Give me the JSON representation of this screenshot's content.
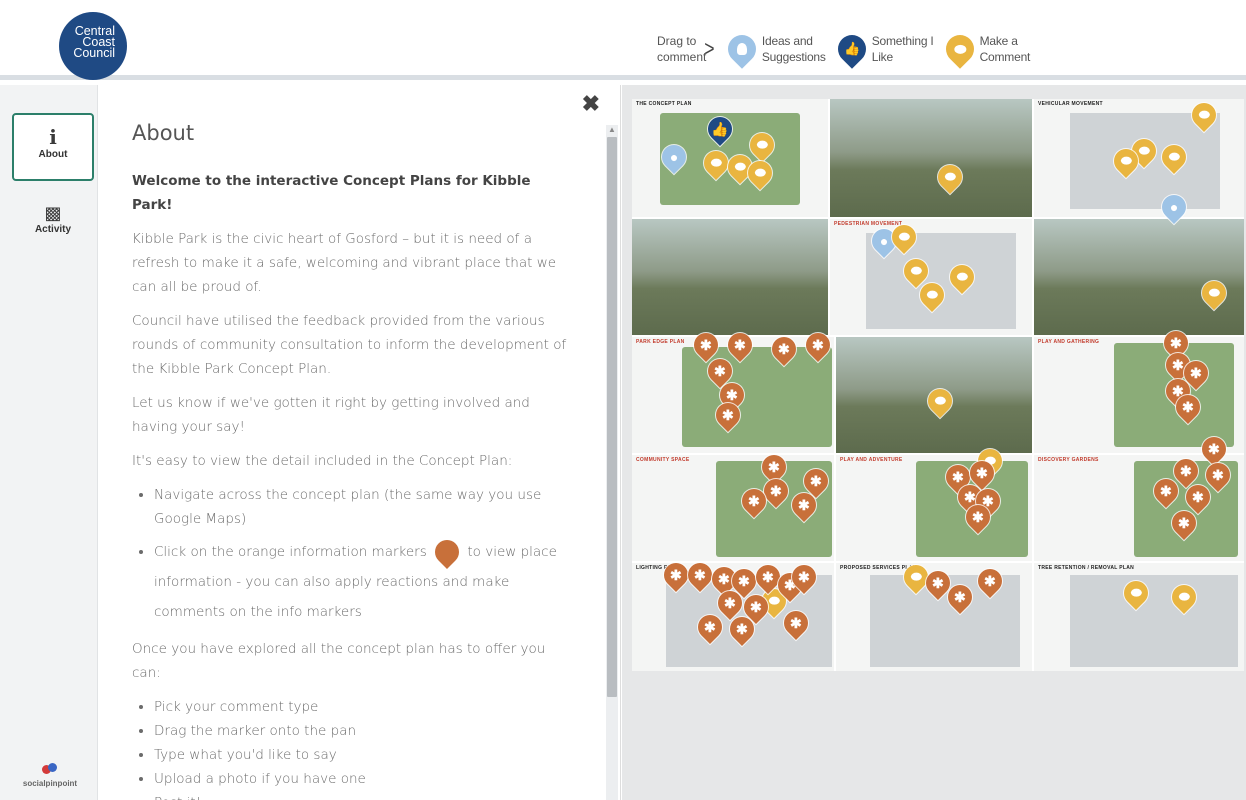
{
  "header": {
    "logo_lines": [
      "Central",
      "Coast",
      "Council"
    ],
    "legend": {
      "drag_line1": "Drag to",
      "drag_line2": "comment",
      "items": [
        {
          "line1": "Ideas and",
          "line2": "Suggestions",
          "color": "#9dc3e6",
          "icon": "lightbulb-icon"
        },
        {
          "line1": "Something I",
          "line2": "Like",
          "color": "#1f4a84",
          "icon": "thumbs-up-icon"
        },
        {
          "line1": "Make a",
          "line2": "Comment",
          "color": "#e9b540",
          "icon": "speech-bubble-icon"
        }
      ]
    }
  },
  "sidebar": {
    "items": [
      {
        "label": "About",
        "icon": "info-icon"
      },
      {
        "label": "Activity",
        "icon": "comments-icon"
      }
    ],
    "brand": "socialpinpoint"
  },
  "about": {
    "title": "About",
    "heading": "Welcome to the interactive Concept Plans for Kibble Park!",
    "p1": "Kibble Park is the civic heart of Gosford – but it is need of a refresh to make it a safe, welcoming and vibrant place that we can all be proud of.",
    "p2": "Council have utilised the feedback provided from the various rounds of community consultation to inform the development of the Kibble Park Concept Plan.",
    "p3": "Let us know if we've gotten it right by getting involved and having your say!",
    "p4": "It's easy to view the detail included in the Concept Plan:",
    "list1": [
      "Navigate across the concept plan (the same way you use Google Maps)",
      "Click on the orange information markers",
      "to view place information - you can also apply reactions and make comments on the info markers"
    ],
    "p5": "Once you have explored all the concept plan has to offer you can:",
    "list2": [
      "Pick your comment type",
      "Drag the marker onto the pan",
      "Type what you'd like to say",
      "Upload a photo if you have one",
      "Post it!"
    ]
  },
  "map": {
    "tile_titles": {
      "t1": "THE CONCEPT PLAN",
      "t3": "VEHICULAR MOVEMENT",
      "t5": "PEDESTRIAN MOVEMENT",
      "t7": "PARK EDGE PLAN",
      "t9": "PLAY AND GATHERING",
      "t10": "COMMUNITY SPACE",
      "t11": "PLAY AND ADVENTURE",
      "t12": "DISCOVERY GARDENS",
      "t13": "LIGHTING PLAN",
      "t14": "PROPOSED SERVICES PLAN",
      "t15": "TREE RETENTION / REMOVAL PLAN"
    },
    "colors": {
      "info": "#c8703a",
      "comment": "#e9b540",
      "idea": "#9dc3e6",
      "like": "#1f4a84"
    }
  }
}
